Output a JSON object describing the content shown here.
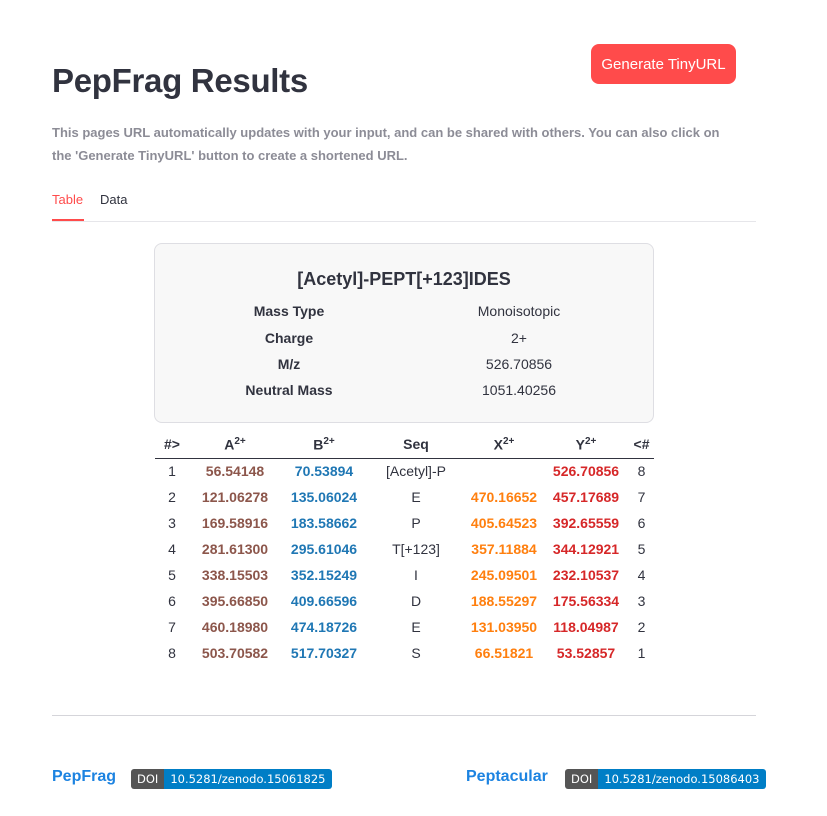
{
  "header": {
    "title": "PepFrag Results",
    "tinyurl_button": "Generate TinyURL",
    "description": "This pages URL automatically updates with your input, and can be shared with others. You can also click on the 'Generate TinyURL' button to create a shortened URL."
  },
  "tabs": [
    {
      "label": "Table",
      "active": true
    },
    {
      "label": "Data",
      "active": false
    }
  ],
  "summary": {
    "sequence": "[Acetyl]-PEPT[+123]IDES",
    "rows": [
      {
        "label": "Mass Type",
        "value": "Monoisotopic"
      },
      {
        "label": "Charge",
        "value": "2+"
      },
      {
        "label": "M/z",
        "value": "526.70856"
      },
      {
        "label": "Neutral Mass",
        "value": "1051.40256"
      }
    ]
  },
  "fragment_table": {
    "headers": {
      "num": "#>",
      "a": "A",
      "a_sup": "2+",
      "b": "B",
      "b_sup": "2+",
      "seq": "Seq",
      "x": "X",
      "x_sup": "2+",
      "y": "Y",
      "y_sup": "2+",
      "rnum": "<#"
    },
    "rows": [
      {
        "num": "1",
        "a": "56.54148",
        "b": "70.53894",
        "seq": "[Acetyl]-P",
        "x": "",
        "y": "526.70856",
        "rnum": "8"
      },
      {
        "num": "2",
        "a": "121.06278",
        "b": "135.06024",
        "seq": "E",
        "x": "470.16652",
        "y": "457.17689",
        "rnum": "7"
      },
      {
        "num": "3",
        "a": "169.58916",
        "b": "183.58662",
        "seq": "P",
        "x": "405.64523",
        "y": "392.65559",
        "rnum": "6"
      },
      {
        "num": "4",
        "a": "281.61300",
        "b": "295.61046",
        "seq": "T[+123]",
        "x": "357.11884",
        "y": "344.12921",
        "rnum": "5"
      },
      {
        "num": "5",
        "a": "338.15503",
        "b": "352.15249",
        "seq": "I",
        "x": "245.09501",
        "y": "232.10537",
        "rnum": "4"
      },
      {
        "num": "6",
        "a": "395.66850",
        "b": "409.66596",
        "seq": "D",
        "x": "188.55297",
        "y": "175.56334",
        "rnum": "3"
      },
      {
        "num": "7",
        "a": "460.18980",
        "b": "474.18726",
        "seq": "E",
        "x": "131.03950",
        "y": "118.04987",
        "rnum": "2"
      },
      {
        "num": "8",
        "a": "503.70582",
        "b": "517.70327",
        "seq": "S",
        "x": "66.51821",
        "y": "53.52857",
        "rnum": "1"
      }
    ]
  },
  "footer": {
    "left_link": "PepFrag",
    "left_badge": {
      "label": "DOI",
      "value": "10.5281/zenodo.15061825"
    },
    "right_link": "Peptacular",
    "right_badge": {
      "label": "DOI",
      "value": "10.5281/zenodo.15086403"
    }
  },
  "colors": {
    "accent": "#ff4b4b",
    "a_ion": "#8c564b",
    "b_ion": "#1f77b4",
    "x_ion": "#ff7f0e",
    "y_ion": "#d62728",
    "link": "#1c83e1"
  }
}
